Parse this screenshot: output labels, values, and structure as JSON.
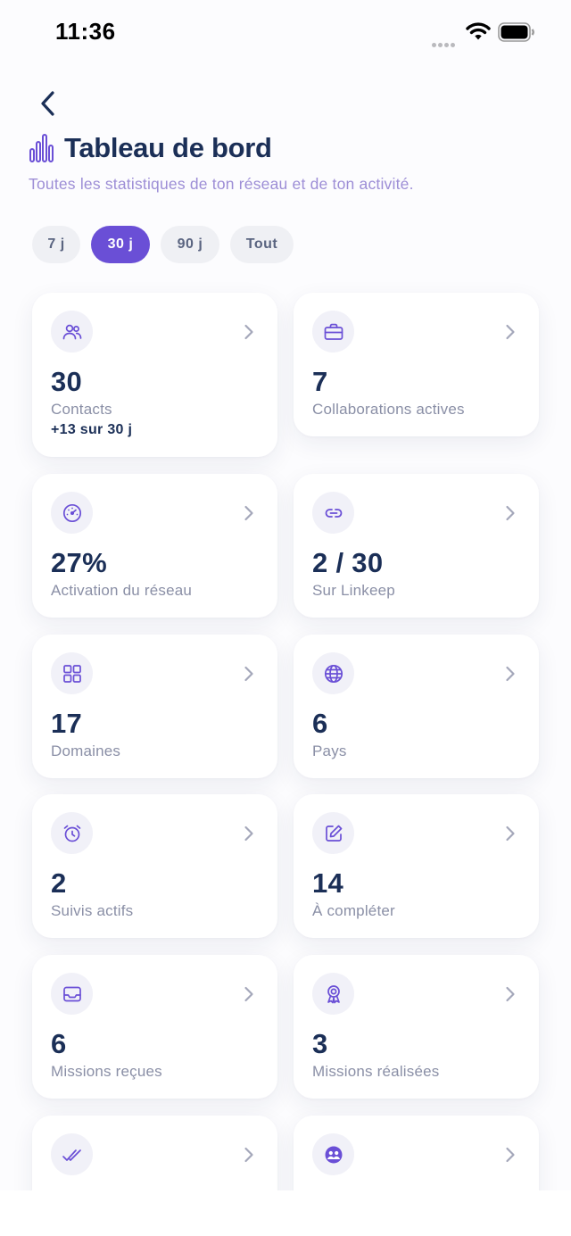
{
  "status_bar": {
    "time": "11:36"
  },
  "header": {
    "title": "Tableau de bord",
    "subtitle": "Toutes les statistiques de ton réseau et de ton activité."
  },
  "period_filters": [
    {
      "label": "7 j",
      "selected": false
    },
    {
      "label": "30 j",
      "selected": true
    },
    {
      "label": "90 j",
      "selected": false
    },
    {
      "label": "Tout",
      "selected": false
    }
  ],
  "accent_color": "#6a4fd6",
  "cards": [
    {
      "icon": "users-icon",
      "value": "30",
      "label": "Contacts",
      "delta": "+13 sur 30 j"
    },
    {
      "icon": "briefcase-icon",
      "value": "7",
      "label": "Collaborations actives"
    },
    {
      "icon": "gauge-icon",
      "value": "27%",
      "label": "Activation du réseau"
    },
    {
      "icon": "link-icon",
      "value": "2 / 30",
      "label": "Sur Linkeep"
    },
    {
      "icon": "grid-icon",
      "value": "17",
      "label": "Domaines"
    },
    {
      "icon": "globe-icon",
      "value": "6",
      "label": "Pays"
    },
    {
      "icon": "alarm-clock-icon",
      "value": "2",
      "label": "Suivis actifs"
    },
    {
      "icon": "edit-icon",
      "value": "14",
      "label": "À compléter"
    },
    {
      "icon": "inbox-icon",
      "value": "6",
      "label": "Missions reçues"
    },
    {
      "icon": "award-icon",
      "value": "3",
      "label": "Missions réalisées"
    },
    {
      "icon": "double-check-icon"
    },
    {
      "icon": "team-icon"
    }
  ]
}
